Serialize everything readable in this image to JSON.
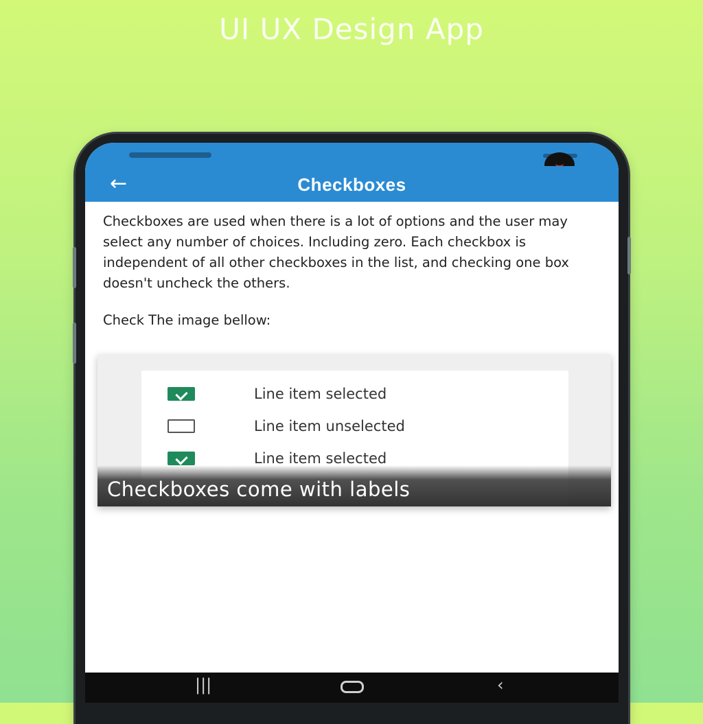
{
  "promo": {
    "title": "UI UX Design App"
  },
  "app_bar": {
    "title": "Checkboxes",
    "back_icon": "arrow-left-icon"
  },
  "content": {
    "description": "Checkboxes are used when there is a lot of options and the user may select any number of choices. Including zero. Each checkbox is independent of all other checkboxes in the list, and checking one box doesn't uncheck the others.",
    "prompt": "Check The image bellow:"
  },
  "figure": {
    "items": [
      {
        "label": "Line item selected",
        "checked": true
      },
      {
        "label": "Line item unselected",
        "checked": false
      },
      {
        "label": "Line item selected",
        "checked": true
      }
    ],
    "caption": "Checkboxes come with labels"
  },
  "nav": {
    "recents_icon": "recents-icon",
    "home_icon": "home-icon",
    "back_icon": "back-icon"
  },
  "colors": {
    "app_bar": "#2a8bd3",
    "checkbox_checked": "#1f8a5b",
    "background_top": "#d3f878",
    "background_bottom": "#90e191"
  }
}
